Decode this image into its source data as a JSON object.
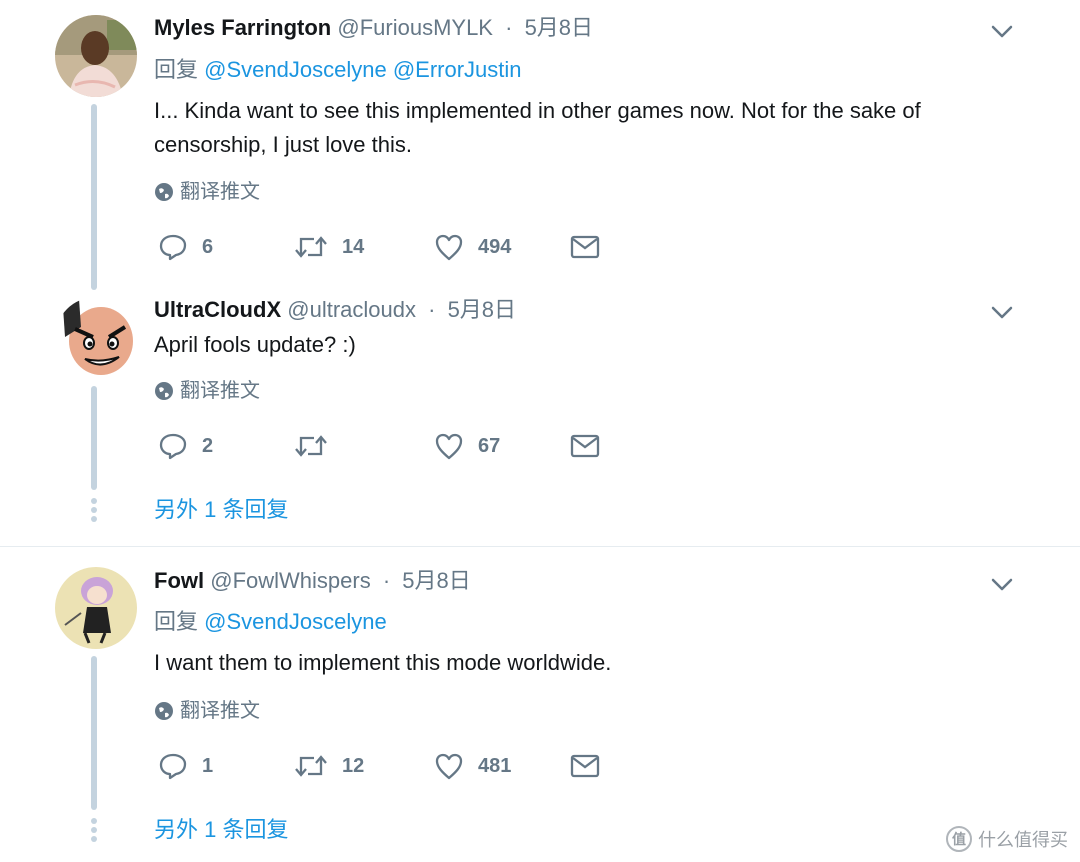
{
  "tweets": [
    {
      "name": "Myles Farrington",
      "handle": "@FuriousMYLK",
      "sep": "·",
      "date": "5月8日",
      "reply_prefix": "回复",
      "mentions": [
        "@SvendJoscelyne",
        "@ErrorJustin"
      ],
      "text": "I... Kinda want to see this implemented in other games now. Not for the sake of censorship, I just love this.",
      "translate": "翻译推文",
      "replies": "6",
      "retweets": "14",
      "likes": "494"
    },
    {
      "name": "UltraCloudX",
      "handle": "@ultracloudx",
      "sep": "·",
      "date": "5月8日",
      "text": "April fools update? :)",
      "translate": "翻译推文",
      "replies": "2",
      "retweets": "",
      "likes": "67",
      "more_replies": "另外 1 条回复"
    },
    {
      "name": "Fowl",
      "handle": "@FowlWhispers",
      "sep": "·",
      "date": "5月8日",
      "reply_prefix": "回复",
      "mentions": [
        "@SvendJoscelyne"
      ],
      "text": "I want them to implement this mode worldwide.",
      "translate": "翻译推文",
      "replies": "1",
      "retweets": "12",
      "likes": "481",
      "more_replies": "另外 1 条回复"
    }
  ],
  "watermark": {
    "glyph": "值",
    "text": "什么值得买"
  },
  "colors": {
    "link": "#1b95e0",
    "muted": "#657786",
    "thread_line": "#c4d3df"
  },
  "icons": [
    "reply-icon",
    "retweet-icon",
    "like-icon",
    "direct-message-icon",
    "globe-icon",
    "chevron-down-icon"
  ]
}
